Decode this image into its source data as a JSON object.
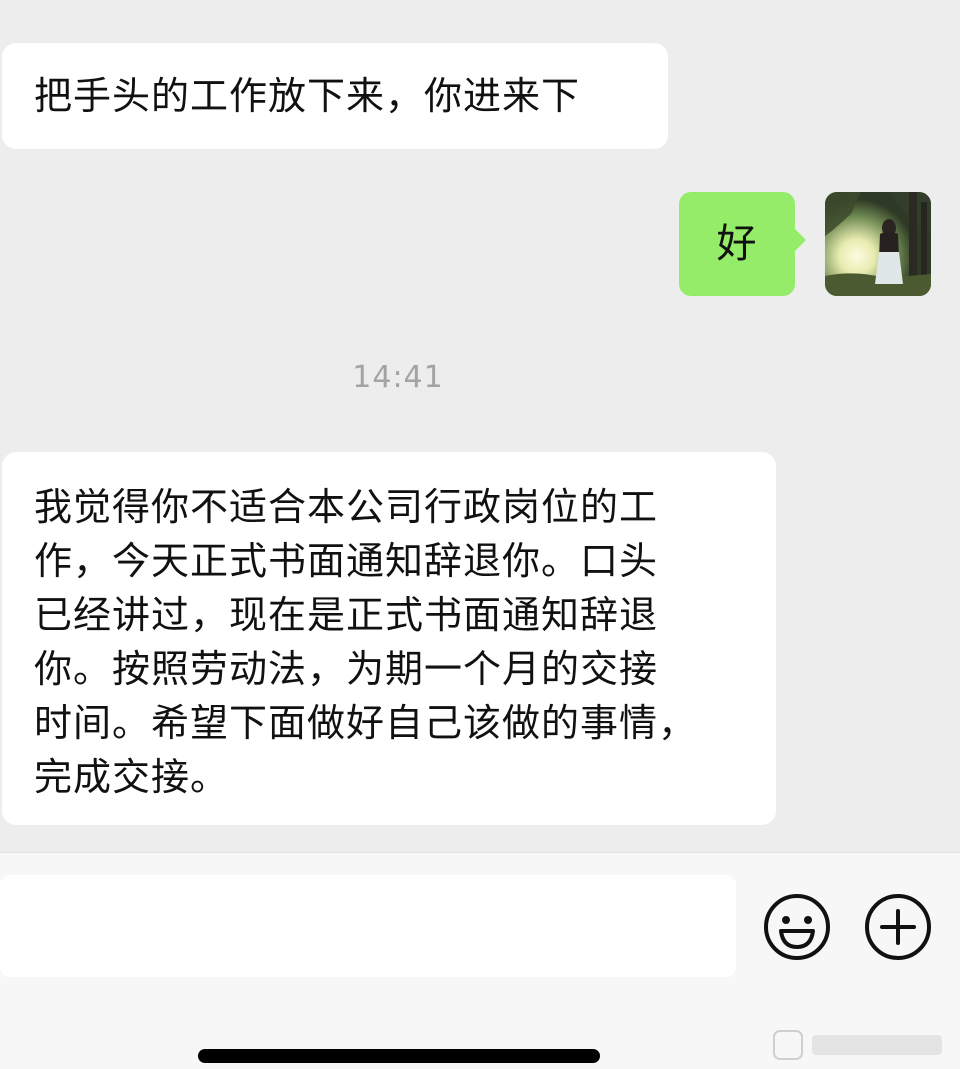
{
  "messages": {
    "first": "把手头的工作放下来，你进来下",
    "reply": "好",
    "timestamp": "14:41",
    "long_lines": [
      "我觉得你不适合本公司行政岗位的工",
      "作，今天正式书面通知辞退你。口头",
      "已经讲过，现在是正式书面通知辞退",
      "你。按照劳动法，为期一个月的交接",
      "时间。希望下面做好自己该做的事情，",
      "完成交接。"
    ]
  },
  "input": {
    "value": "",
    "placeholder": ""
  },
  "icons": {
    "emoji": "smiley-face-icon",
    "more": "plus-circle-icon",
    "avatar": "user-avatar-photo"
  },
  "colors": {
    "background": "#ededed",
    "received_bubble": "#ffffff",
    "sent_bubble": "#95ec69",
    "timestamp_text": "#a3a3a3"
  }
}
